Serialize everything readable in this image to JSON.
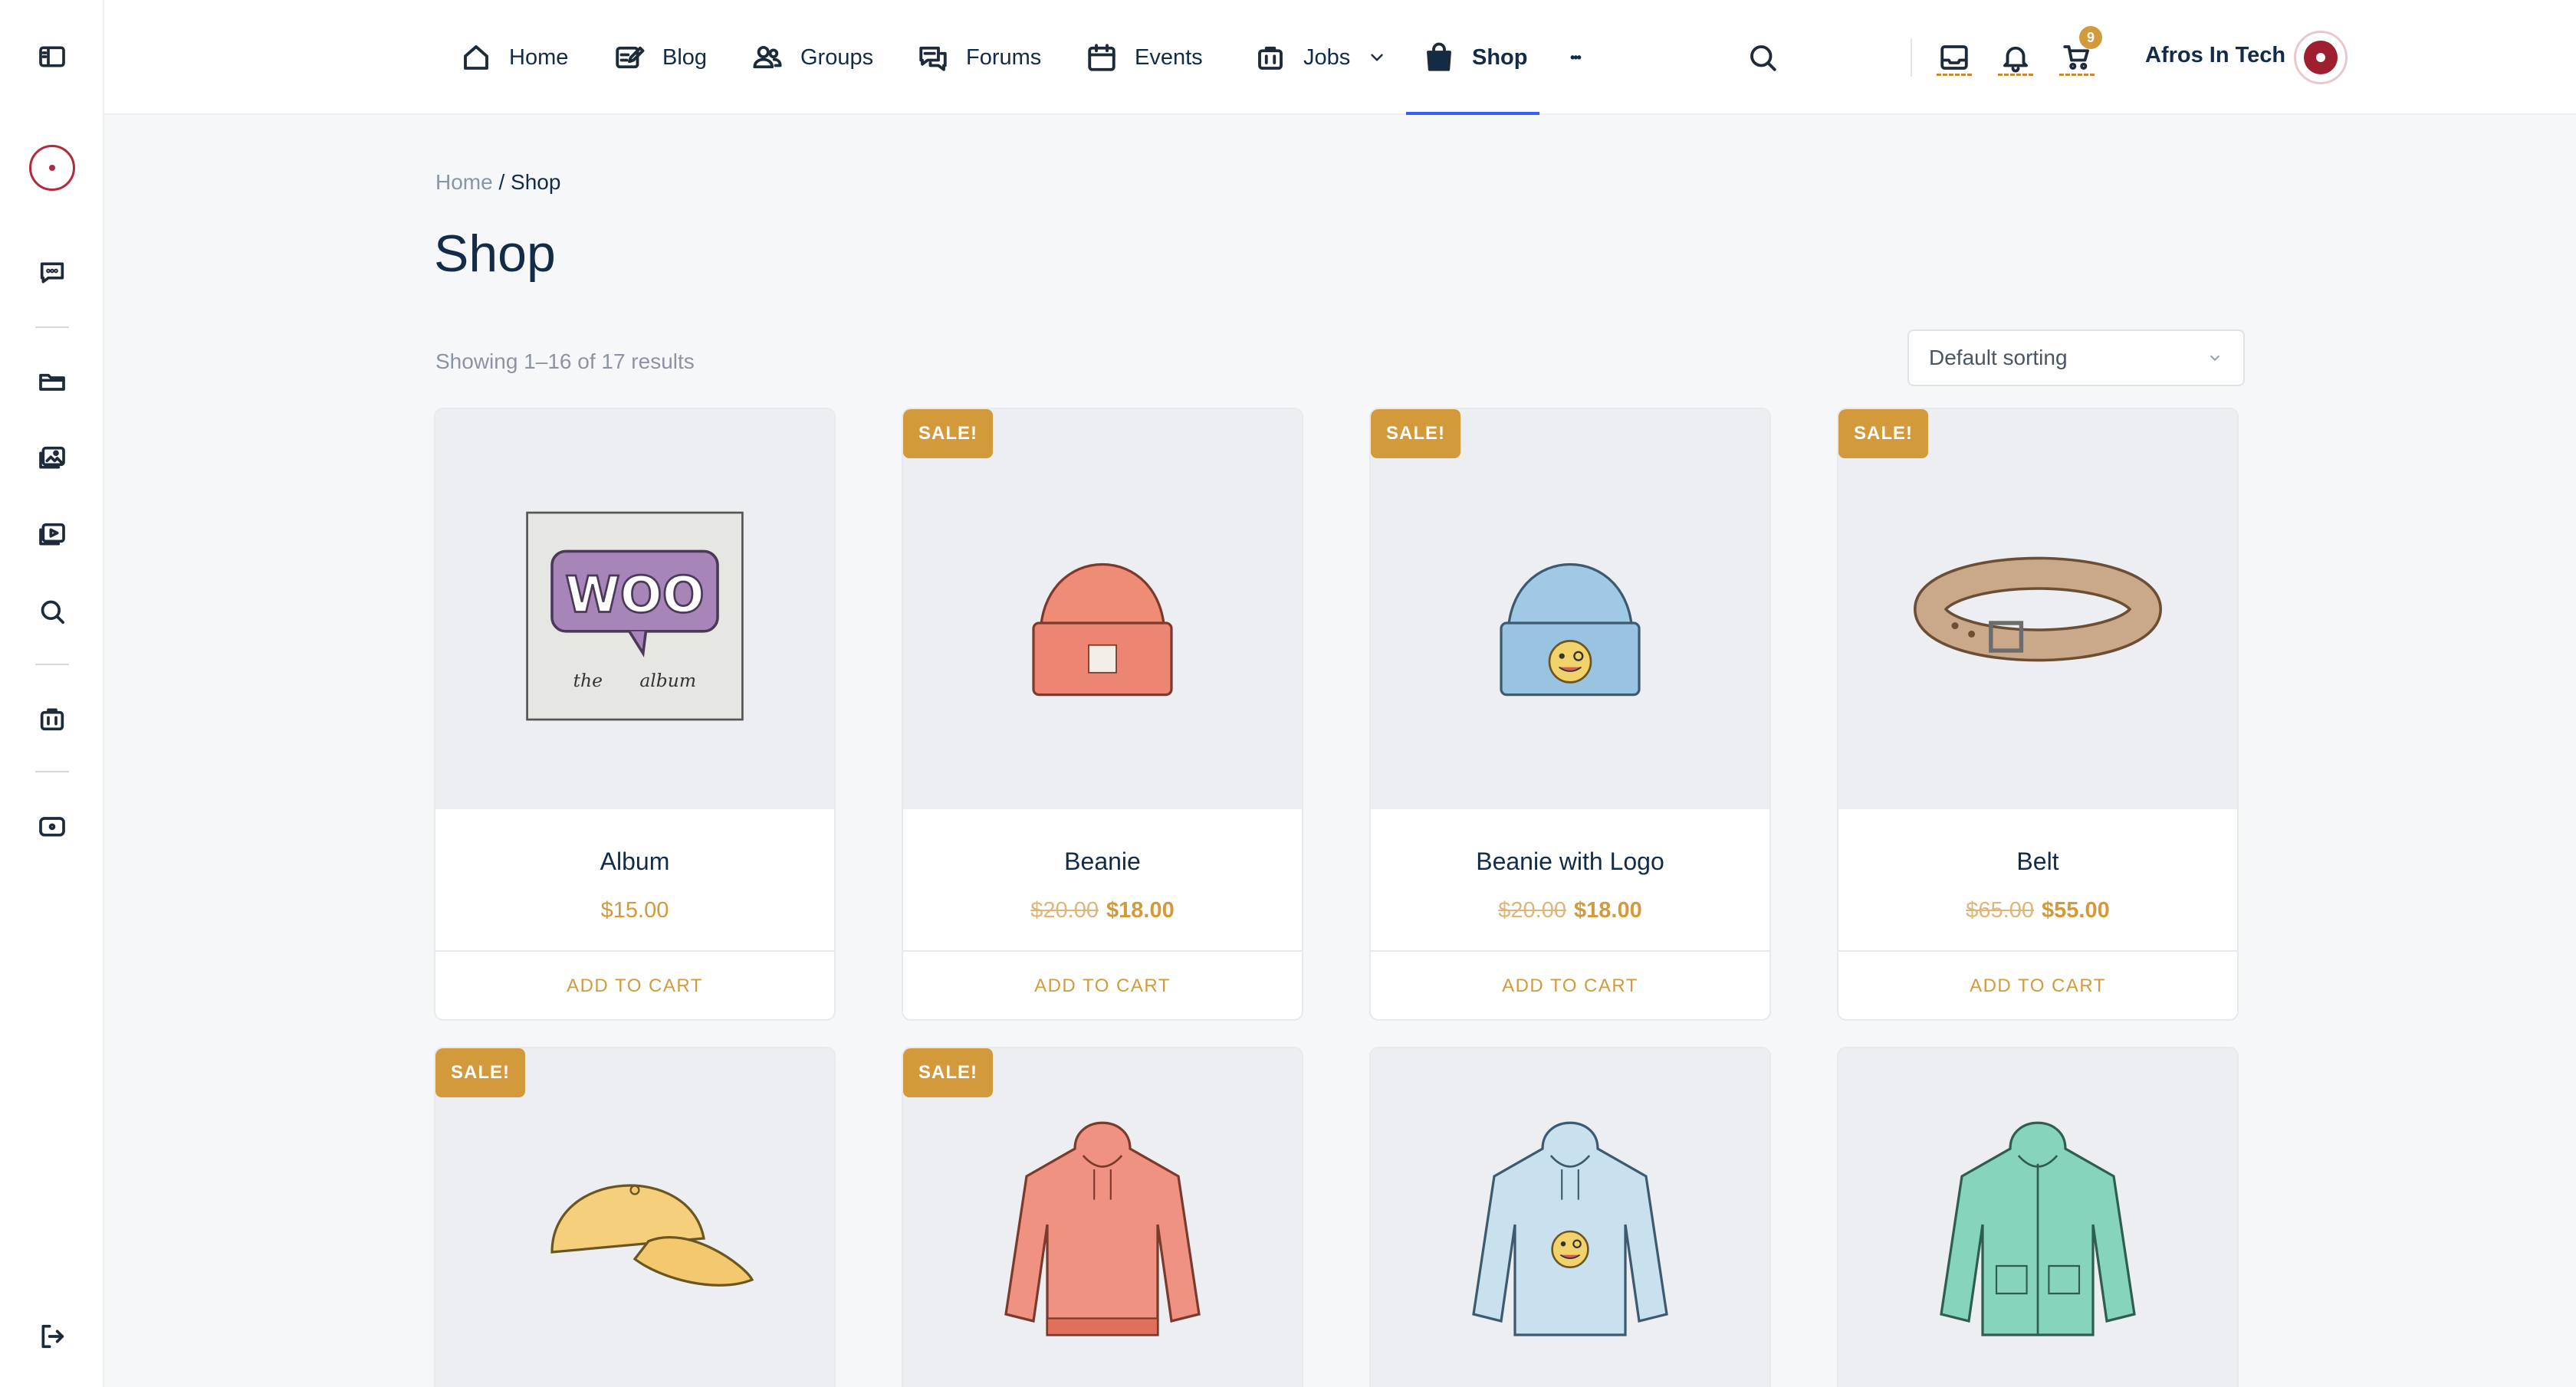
{
  "header": {
    "nav": [
      {
        "label": "Home",
        "icon": "home-icon"
      },
      {
        "label": "Blog",
        "icon": "blog-icon"
      },
      {
        "label": "Groups",
        "icon": "groups-icon"
      },
      {
        "label": "Forums",
        "icon": "forums-icon"
      },
      {
        "label": "Events",
        "icon": "calendar-icon"
      },
      {
        "label": "Jobs",
        "icon": "briefcase-icon"
      },
      {
        "label": "Shop",
        "icon": "bag-icon"
      },
      {
        "label": "•••",
        "icon": "more-icon"
      }
    ],
    "active_nav": "Shop",
    "cart_count": "9",
    "user_name": "Afros In Tech"
  },
  "sidebar": {
    "icons": [
      "sidebar-toggle-icon",
      "site-logo",
      "messages-icon",
      "folder-icon",
      "photos-icon",
      "videos-icon",
      "search-icon",
      "briefcase-icon",
      "wallet-icon",
      "logout-icon"
    ]
  },
  "breadcrumb": {
    "home": "Home",
    "separator": " / ",
    "current": "Shop"
  },
  "page": {
    "title": "Shop",
    "result_count": "Showing 1–16 of 17 results",
    "sort_label": "Default sorting"
  },
  "products": [
    {
      "name": "Album",
      "sale": "",
      "old_price": "",
      "price": "$15.00",
      "cta": "ADD TO CART"
    },
    {
      "name": "Beanie",
      "sale": "SALE!",
      "old_price": "$20.00",
      "price": "$18.00",
      "cta": "ADD TO CART"
    },
    {
      "name": "Beanie with Logo",
      "sale": "SALE!",
      "old_price": "$20.00",
      "price": "$18.00",
      "cta": "ADD TO CART"
    },
    {
      "name": "Belt",
      "sale": "SALE!",
      "old_price": "$65.00",
      "price": "$55.00",
      "cta": "ADD TO CART"
    },
    {
      "name": "",
      "sale": "SALE!",
      "old_price": "",
      "price": "",
      "cta": ""
    },
    {
      "name": "",
      "sale": "SALE!",
      "old_price": "",
      "price": "",
      "cta": ""
    },
    {
      "name": "",
      "sale": "",
      "old_price": "",
      "price": "",
      "cta": ""
    },
    {
      "name": "",
      "sale": "",
      "old_price": "",
      "price": "",
      "cta": ""
    }
  ],
  "album_art": {
    "logo_text": "WOO",
    "caption_1": "the",
    "caption_2": "album"
  },
  "colors": {
    "accent": "#d39a3c",
    "active_underline": "#385dff",
    "brand_red": "#b32a3a"
  }
}
